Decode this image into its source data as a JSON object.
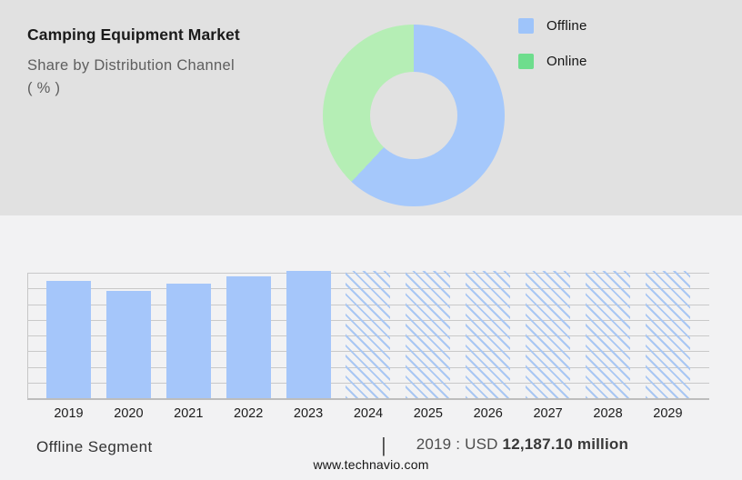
{
  "header": {
    "title": "Camping Equipment Market",
    "subtitle": "Share by Distribution Channel",
    "unit_line": "( % )"
  },
  "legend": {
    "items": [
      {
        "label": "Offline",
        "swatch_color": "#9ec4fa"
      },
      {
        "label": "Online",
        "swatch_color": "#6edd8d"
      }
    ]
  },
  "chart_data": [
    {
      "type": "pie",
      "donut": true,
      "title": "Camping Equipment Market - Share by Distribution Channel (%)",
      "labels": [
        "Offline",
        "Online"
      ],
      "values_pct_estimated": [
        62,
        38
      ],
      "colors": [
        "#a5c8fb",
        "#b5eeb5"
      ],
      "legend_position": "right",
      "start_angle_deg": 0,
      "direction": "clockwise"
    },
    {
      "type": "bar",
      "categories": [
        "2019",
        "2020",
        "2021",
        "2022",
        "2023",
        "2024",
        "2025",
        "2026",
        "2027",
        "2028",
        "2029"
      ],
      "series": [
        {
          "name": "Offline Segment",
          "unit": "USD million",
          "values_usd_million_estimated": [
            12187.1,
            11150,
            11900,
            12630,
            13200,
            null,
            null,
            null,
            null,
            null,
            null
          ],
          "height_pct": [
            92.4,
            84.5,
            90.2,
            95.7,
            100,
            100,
            100,
            100,
            100,
            100,
            100
          ],
          "bar_style": [
            "solid",
            "solid",
            "solid",
            "solid",
            "solid",
            "hatched",
            "hatched",
            "hatched",
            "hatched",
            "hatched",
            "hatched"
          ]
        }
      ],
      "labeled_value": "2019 : USD 12,187.10 million",
      "solid_bar_color": "#a5c6fa",
      "hatch_line_color": "#a9c7f3",
      "grid": {
        "horizontal_lines": 9,
        "gridline_color": "#c9c9c9"
      },
      "y_axis_labels_visible": false
    }
  ],
  "footer": {
    "segment_label": "Offline Segment",
    "separator": "|",
    "value_prefix": "2019 : USD",
    "value_bold": "12,187.10 million",
    "website": "www.technavio.com"
  },
  "colors": {
    "header_bg": "#e1e1e1",
    "body_bg": "#f2f2f3"
  }
}
